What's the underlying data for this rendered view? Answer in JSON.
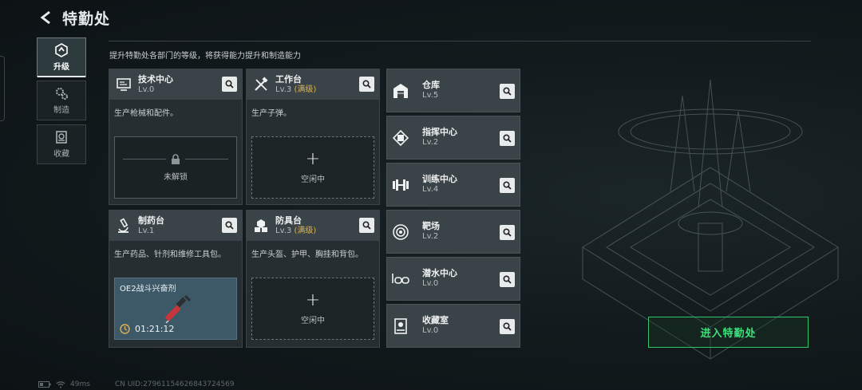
{
  "header": {
    "title": "特勤处",
    "subtitle": "提升特勤处各部门的等级，将获得能力提升和制造能力"
  },
  "nav": [
    {
      "label": "升级",
      "icon": "upgrade-icon",
      "active": true
    },
    {
      "label": "制造",
      "icon": "gears-icon",
      "active": false
    },
    {
      "label": "收藏",
      "icon": "collection-icon",
      "active": false
    }
  ],
  "departments": [
    {
      "name": "技术中心",
      "level": "Lv.0",
      "max": "",
      "icon": "monitor-icon",
      "desc": "生产枪械和配件。",
      "slot": "未解锁"
    },
    {
      "name": "工作台",
      "level": "Lv.3",
      "max": "(满级)",
      "icon": "tools-icon",
      "desc": "生产子弹。",
      "slot_plus": "+",
      "slot": "空闲中"
    },
    {
      "name": "制药台",
      "level": "Lv.1",
      "max": "",
      "icon": "microscope-icon",
      "desc": "生产药品、针剂和维修工具包。",
      "product": "OE2战斗兴奋剂",
      "timer": "01:21:12"
    },
    {
      "name": "防具台",
      "level": "Lv.3",
      "max": "(满级)",
      "icon": "armor-icon",
      "desc": "生产头盔、护甲、胸挂和背包。",
      "slot_plus": "+",
      "slot": "空闲中"
    }
  ],
  "facilities": [
    {
      "name": "仓库",
      "level": "Lv.5",
      "icon": "warehouse-icon"
    },
    {
      "name": "指挥中心",
      "level": "Lv.2",
      "icon": "chip-icon"
    },
    {
      "name": "训练中心",
      "level": "Lv.4",
      "icon": "dumbbell-icon"
    },
    {
      "name": "靶场",
      "level": "Lv.2",
      "icon": "target-icon"
    },
    {
      "name": "潜水中心",
      "level": "Lv.0",
      "icon": "diving-mask-icon"
    },
    {
      "name": "收藏室",
      "level": "Lv.0",
      "icon": "display-case-icon"
    }
  ],
  "enter_button": "进入特勤处",
  "status": {
    "ping": "49ms",
    "uid": "CN UID:27961154626843724569"
  }
}
